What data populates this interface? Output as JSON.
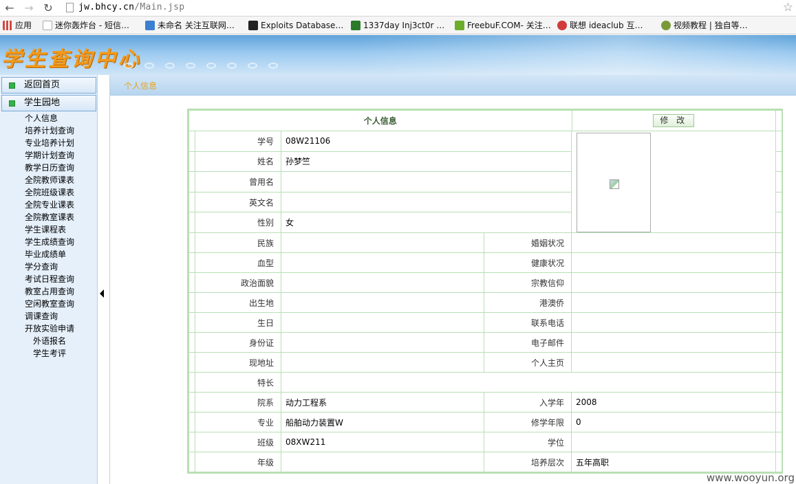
{
  "browser": {
    "url_host": "jw.bhcy.cn",
    "url_path": "/Main.jsp",
    "bookmarks": [
      {
        "label": "应用",
        "color": "#d04a3f"
      },
      {
        "label": "迷你轰炸台 - 短信…",
        "color": "#cccccc"
      },
      {
        "label": "未命名 关注互联网…",
        "color": "#3b7fd0"
      },
      {
        "label": "Exploits Database…",
        "color": "#222222"
      },
      {
        "label": "1337day Inj3ct0r …",
        "color": "#2a7a2a"
      },
      {
        "label": "FreebuF.COM- 关注…",
        "color": "#6cad2c"
      },
      {
        "label": "联想 ideaclub 互…",
        "color": "#d13b3b"
      },
      {
        "label": "视频教程 | 独自等…",
        "color": "#7a9a3a"
      }
    ]
  },
  "banner": {
    "title": "学生查询中心"
  },
  "sidebar": {
    "home": "返回首页",
    "section": "学生园地",
    "items": [
      "个人信息",
      "培养计划查询",
      "专业培养计划",
      "学期计划查询",
      "教学日历查询",
      "全院教师课表",
      "全院班级课表",
      "全院专业课表",
      "全院教室课表",
      "学生课程表",
      "学生成绩查询",
      "毕业成绩单",
      "学分查询",
      "考试日程查询",
      "教室占用查询",
      "空闲教室查询",
      "调课查询",
      "开放实验申请"
    ],
    "sub_items": [
      "外语报名",
      "学生考评"
    ]
  },
  "main": {
    "breadcrumb": "个人信息",
    "panel_title": "个人信息",
    "edit_label": "修 改",
    "fields": {
      "student_id": {
        "label": "学号",
        "value": "08W21106"
      },
      "name": {
        "label": "姓名",
        "value": "孙梦竺"
      },
      "former_name": {
        "label": "曾用名",
        "value": ""
      },
      "english_name": {
        "label": "英文名",
        "value": ""
      },
      "gender": {
        "label": "性别",
        "value": "女"
      },
      "ethnicity": {
        "label": "民族",
        "value": ""
      },
      "marital": {
        "label": "婚姻状况",
        "value": ""
      },
      "blood": {
        "label": "血型",
        "value": ""
      },
      "health": {
        "label": "健康状况",
        "value": ""
      },
      "political": {
        "label": "政治面貌",
        "value": ""
      },
      "religion": {
        "label": "宗教信仰",
        "value": ""
      },
      "birthplace": {
        "label": "出生地",
        "value": ""
      },
      "hk_macau": {
        "label": "港澳侨",
        "value": ""
      },
      "birthday": {
        "label": "生日",
        "value": ""
      },
      "phone": {
        "label": "联系电话",
        "value": ""
      },
      "id_card": {
        "label": "身份证",
        "value": ""
      },
      "email": {
        "label": "电子邮件",
        "value": ""
      },
      "address": {
        "label": "现地址",
        "value": ""
      },
      "homepage": {
        "label": "个人主页",
        "value": ""
      },
      "specialty": {
        "label": "特长",
        "value": ""
      },
      "department": {
        "label": "院系",
        "value": "动力工程系"
      },
      "entry_year": {
        "label": "入学年",
        "value": "2008"
      },
      "major": {
        "label": "专业",
        "value": "船舶动力装置W"
      },
      "duration": {
        "label": "修学年限",
        "value": "0"
      },
      "class": {
        "label": "班级",
        "value": "08XW211"
      },
      "degree": {
        "label": "学位",
        "value": ""
      },
      "grade": {
        "label": "年级",
        "value": ""
      },
      "level": {
        "label": "培养层次",
        "value": "五年高职"
      }
    }
  },
  "watermark": "www.wooyun.org"
}
